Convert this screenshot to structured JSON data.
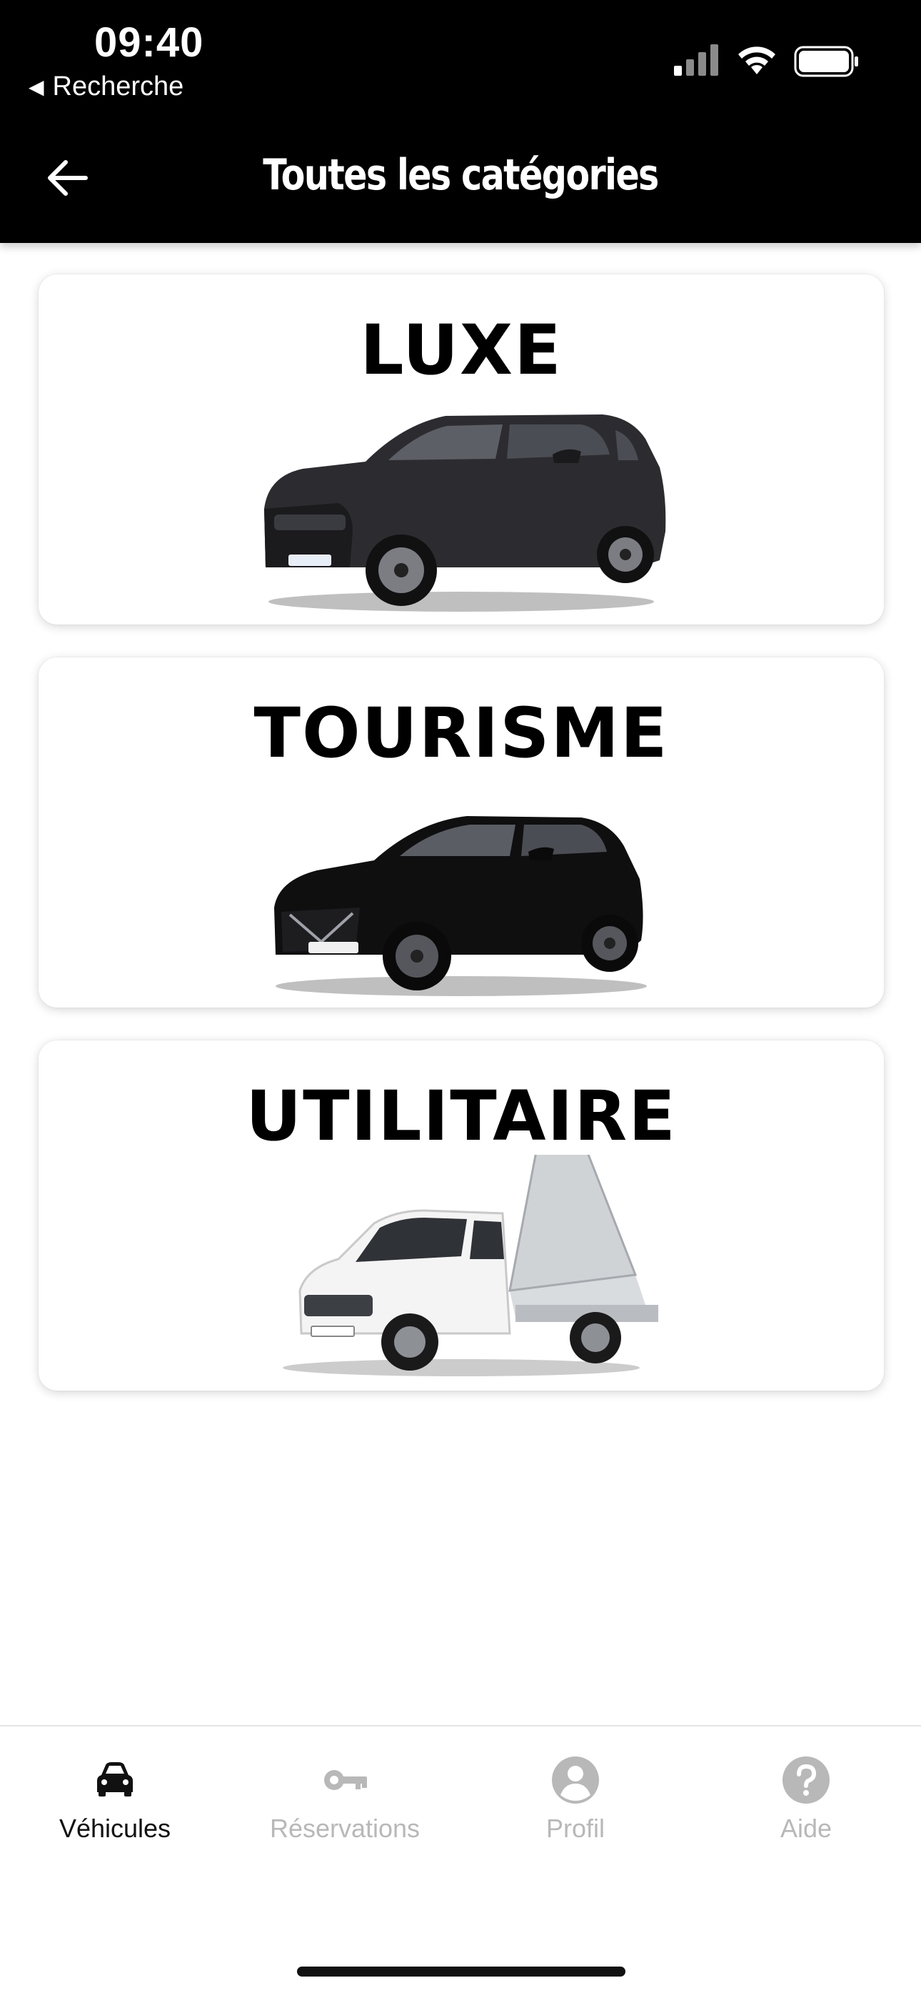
{
  "status_bar": {
    "time": "09:40",
    "back_app_label": "Recherche",
    "icons": [
      "cellular-signal-icon",
      "wifi-icon",
      "battery-icon"
    ]
  },
  "nav": {
    "back_icon": "arrow-left-icon",
    "title": "Toutes les catégories"
  },
  "categories": [
    {
      "label": "LUXE",
      "image": "luxury-suv"
    },
    {
      "label": "TOURISME",
      "image": "compact-suv"
    },
    {
      "label": "UTILITAIRE",
      "image": "tipper-van"
    }
  ],
  "tabbar": {
    "tabs": [
      {
        "label": "Véhicules",
        "icon": "car-icon",
        "active": true
      },
      {
        "label": "Réservations",
        "icon": "key-icon",
        "active": false
      },
      {
        "label": "Profil",
        "icon": "user-icon",
        "active": false
      },
      {
        "label": "Aide",
        "icon": "help-icon",
        "active": false
      }
    ]
  },
  "colors": {
    "header_bg": "#000000",
    "tab_active": "#111111",
    "tab_inactive": "#b8b8b8"
  }
}
